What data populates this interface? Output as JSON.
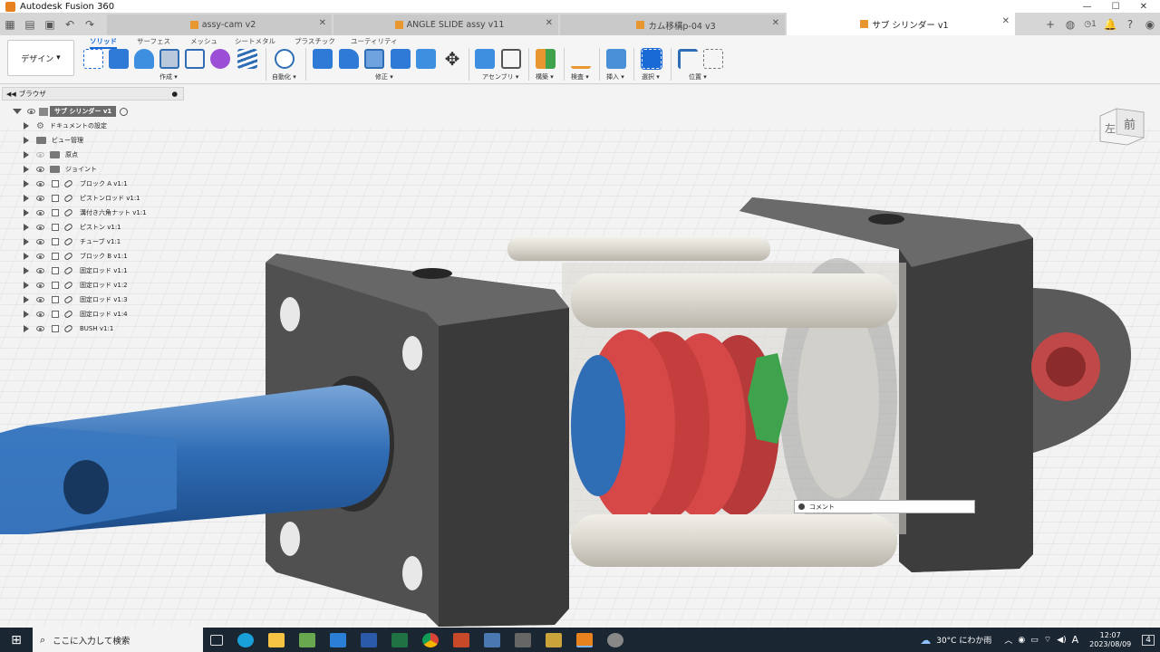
{
  "app": {
    "title": "Autodesk Fusion 360"
  },
  "doc_tabs": [
    {
      "label": "assy-cam v2",
      "active": false
    },
    {
      "label": "ANGLE SLIDE assy v11",
      "active": false
    },
    {
      "label": "カム移構p-04 v3",
      "active": false
    },
    {
      "label": "サブ シリンダー v1",
      "active": true
    }
  ],
  "notification_count": "1",
  "toolbar": {
    "workspace": "デザイン",
    "tabs": [
      "ソリッド",
      "サーフェス",
      "メッシュ",
      "シートメタル",
      "プラスチック",
      "ユーティリティ"
    ],
    "groups": [
      "作成",
      "自動化",
      "修正",
      "アセンブリ",
      "構築",
      "検査",
      "挿入",
      "選択",
      "位置"
    ]
  },
  "browser": {
    "header": "ブラウザ",
    "root": "サブ シリンダー v1",
    "items": [
      {
        "label": "ドキュメントの設定",
        "kind": "settings"
      },
      {
        "label": "ビュー管理",
        "kind": "folder"
      },
      {
        "label": "原点",
        "kind": "folder"
      },
      {
        "label": "ジョイント",
        "kind": "folder"
      },
      {
        "label": "ブロック A v1:1",
        "kind": "component"
      },
      {
        "label": "ピストンロッド v1:1",
        "kind": "component"
      },
      {
        "label": "溝付き六角ナット v1:1",
        "kind": "component"
      },
      {
        "label": "ピストン v1:1",
        "kind": "component"
      },
      {
        "label": "チューブ v1:1",
        "kind": "component"
      },
      {
        "label": "ブロック B v1:1",
        "kind": "component"
      },
      {
        "label": "固定ロッド v1:1",
        "kind": "component"
      },
      {
        "label": "固定ロッド v1:2",
        "kind": "component"
      },
      {
        "label": "固定ロッド v1:3",
        "kind": "component"
      },
      {
        "label": "固定ロッド v1:4",
        "kind": "component"
      },
      {
        "label": "BUSH v1:1",
        "kind": "component"
      }
    ]
  },
  "viewcube": {
    "left": "左",
    "front": "前"
  },
  "comment": {
    "label": "コメント"
  },
  "taskbar": {
    "search_placeholder": "ここに入力して検索",
    "weather": "30°C にわか雨",
    "ime": "A",
    "time": "12:07",
    "date": "2023/08/09",
    "notifications": "4"
  },
  "colors": {
    "accent": "#1a6ad6",
    "rod": "#2f6db5",
    "piston": "#d64848",
    "block": "#555555"
  }
}
